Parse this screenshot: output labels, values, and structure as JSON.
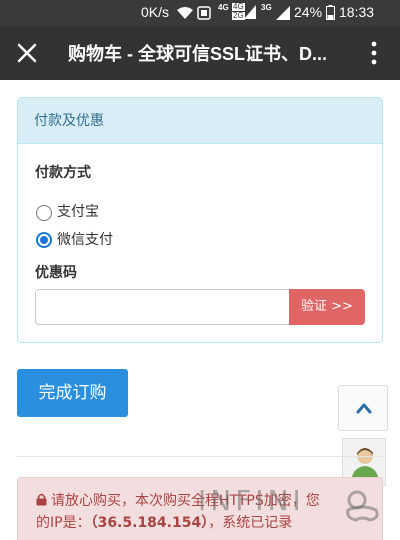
{
  "status_bar": {
    "net_speed": "0K/s",
    "lte_4g_a": "4G",
    "lte_4g_b": "4G",
    "lte_2g": "2G",
    "net_3g": "3G",
    "battery": "24%",
    "time": "18:33"
  },
  "app_bar": {
    "title": "购物车 - 全球可信SSL证书、D..."
  },
  "payment_panel": {
    "heading": "付款及优惠",
    "method_label": "付款方式",
    "options": [
      {
        "label": "支付宝",
        "selected": false
      },
      {
        "label": "微信支付",
        "selected": true
      }
    ],
    "coupon_label": "优惠码",
    "coupon_value": "",
    "verify_label": "验证 >>"
  },
  "complete_label": "完成订购",
  "notice": {
    "text_line1": "请放心购买，本次购买全程HTTPS加密，您",
    "text_line2_prefix": "的IP是：",
    "ip": "（36.5.184.154）",
    "text_line2_suffix": "，系统已记录"
  },
  "watermark": "INFINI",
  "colors": {
    "panel_header_bg": "#d9edf7",
    "panel_header_text": "#31708f",
    "verify_button": "#e06666",
    "complete_button": "#2b8fe0",
    "alert_bg": "#f2dede",
    "alert_text": "#a94442",
    "app_bar": "#333333"
  }
}
